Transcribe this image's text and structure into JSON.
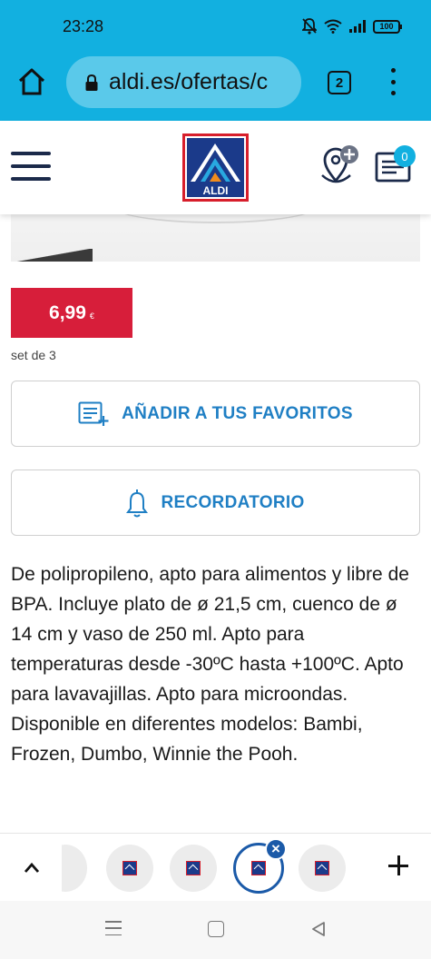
{
  "status_bar": {
    "time": "23:28",
    "battery": "100",
    "icons": [
      "mute-icon",
      "wifi-icon",
      "signal-icon",
      "battery-icon"
    ]
  },
  "browser": {
    "url": "aldi.es/ofertas/c",
    "tab_count": "2",
    "colors": {
      "toolbar": "#12b0e0",
      "url_bar": "#5ac9ea"
    }
  },
  "site_header": {
    "logo_text": "ALDI",
    "list_badge_count": "0",
    "icons": [
      "hamburger-menu-icon",
      "store-locator-icon",
      "shopping-list-icon"
    ]
  },
  "product": {
    "price": "6,99",
    "currency": "€",
    "unit": "set de 3",
    "price_color": "#d71e3a"
  },
  "actions": {
    "favorites_label": "AÑADIR A TUS FAVORITOS",
    "reminder_label": "RECORDATORIO",
    "accent_color": "#1f7fc4"
  },
  "description": "De polipropileno, apto para alimentos y libre de BPA. Incluye plato de ø 21,5 cm, cuenco de ø 14 cm y vaso de 250 ml. Apto para temperaturas desde -30ºC hasta +100ºC. Apto para lavavajillas. Apto para microondas. Disponible en diferentes modelos: Bambi, Frozen, Dumbo, Winnie the Pooh.",
  "recently_viewed": {
    "close_glyph": "×"
  }
}
